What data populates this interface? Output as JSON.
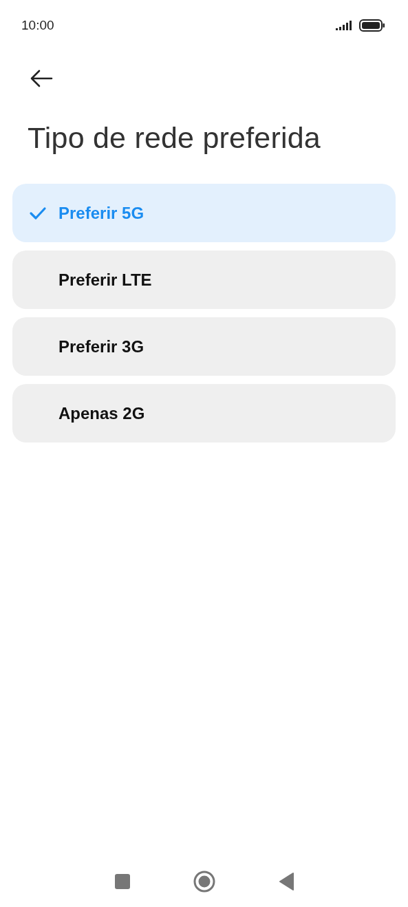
{
  "status_bar": {
    "time": "10:00"
  },
  "title": "Tipo de rede preferida",
  "options": [
    {
      "label": "Preferir 5G",
      "selected": true
    },
    {
      "label": "Preferir LTE",
      "selected": false
    },
    {
      "label": "Preferir 3G",
      "selected": false
    },
    {
      "label": "Apenas 2G",
      "selected": false
    }
  ]
}
